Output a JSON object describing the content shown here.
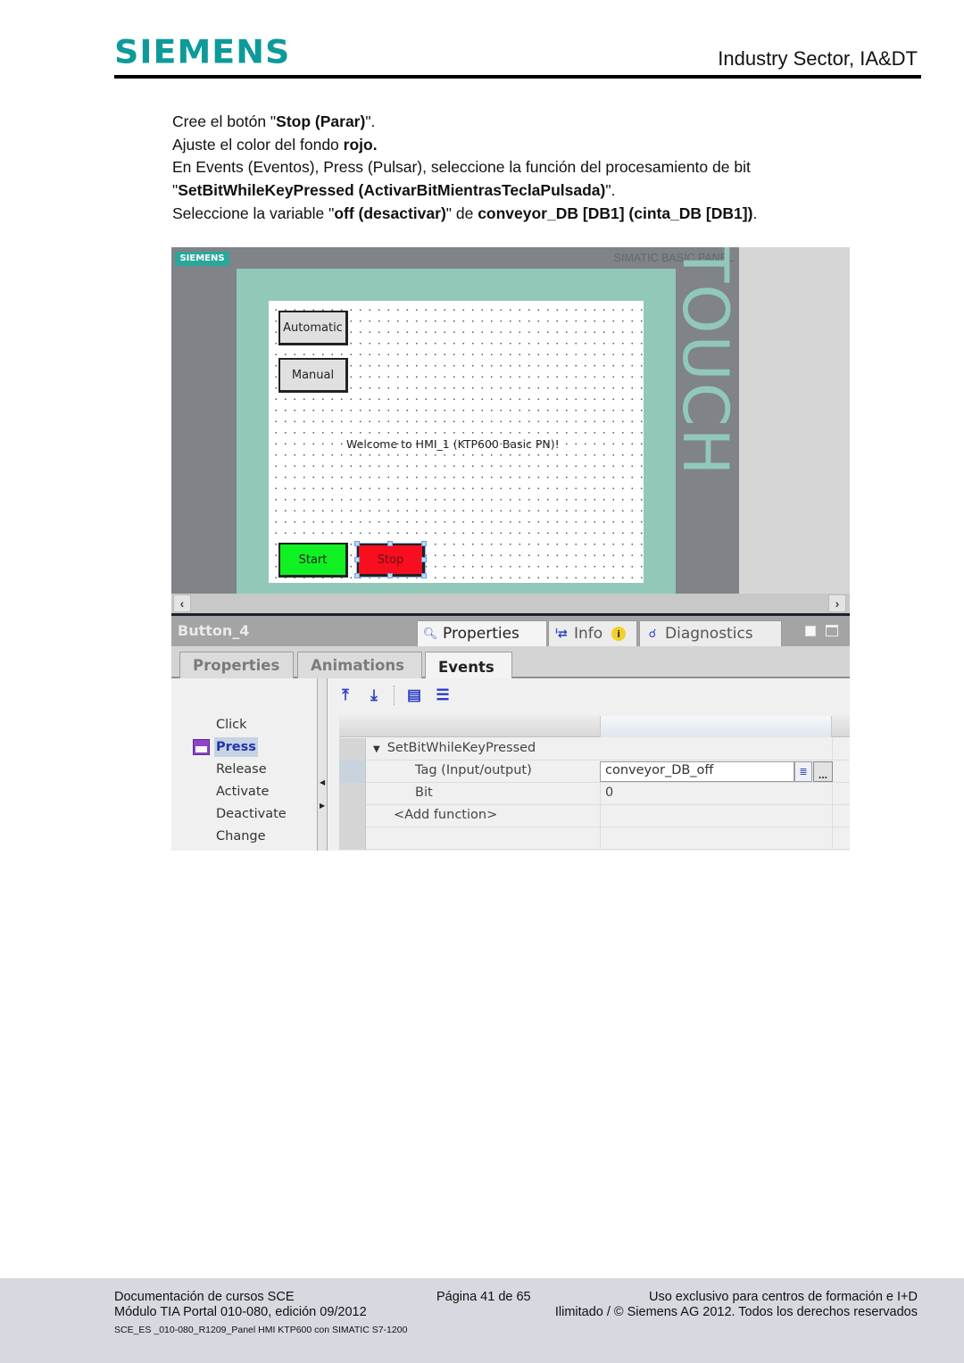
{
  "header": {
    "brand": "SIEMENS",
    "sector": "Industry Sector, IA&DT"
  },
  "instructions": {
    "line1": {
      "pre": "Cree el botón \"",
      "bold": "Stop (Parar)",
      "post": "\"."
    },
    "line2": {
      "pre": "Ajuste el color del fondo ",
      "bold": "rojo.",
      "post": ""
    },
    "line3": "En Events (Eventos), Press (Pulsar), seleccione la función del procesamiento de bit",
    "line4": {
      "pre": "\"",
      "bold": "SetBitWhileKeyPressed (ActivarBitMientrasTeclaPulsada)",
      "post": "\"."
    },
    "line5": {
      "pre": "Seleccione la variable \"",
      "bold1": "off (desactivar)",
      "mid": "\" de ",
      "bold2": "conveyor_DB [DB1] (cinta_DB [DB1])",
      "post": "."
    }
  },
  "hmi": {
    "device_logo": "SIEMENS",
    "device_model": "SIMATIC BASIC PANEL",
    "touch_label": "TOUCH",
    "buttons": {
      "automatic": "Automatic",
      "manual": "Manual",
      "start": "Start",
      "stop": "Stop"
    },
    "welcome_text": "Welcome to HMI_1 (KTP600 Basic PN)!",
    "colors": {
      "start": "#0ff123",
      "stop": "#f70e1f",
      "bezel": "#91c8ba"
    }
  },
  "inspector": {
    "object_name": "Button_4",
    "main_tabs": [
      {
        "label": "Properties",
        "icon": "properties-icon",
        "active": true
      },
      {
        "label": "Info",
        "icon": "info-icon",
        "active": false
      },
      {
        "label": "Diagnostics",
        "icon": "diagnostics-icon",
        "active": false
      }
    ],
    "sub_tabs": [
      {
        "label": "Properties",
        "active": false
      },
      {
        "label": "Animations",
        "active": false
      },
      {
        "label": "Events",
        "active": true
      }
    ],
    "events": [
      "Click",
      "Press",
      "Release",
      "Activate",
      "Deactivate",
      "Change"
    ],
    "selected_event": "Press",
    "function_list": {
      "function_name": "SetBitWhileKeyPressed",
      "params": [
        {
          "name": "Tag (Input/output)",
          "value": "conveyor_DB_off"
        },
        {
          "name": "Bit",
          "value": "0"
        }
      ],
      "add_function": "<Add function>"
    }
  },
  "footer": {
    "left1": "Documentación de cursos SCE",
    "left2": "Módulo TIA Portal 010-080, edición 09/2012",
    "page": "Página 41 de 65",
    "right1": "Uso exclusivo para centros de formación e I+D",
    "right2": "Ilimitado / © Siemens AG 2012. Todos los derechos reservados",
    "filename": "SCE_ES _010-080_R1209_Panel HMI KTP600 con SIMATIC S7-1200"
  }
}
